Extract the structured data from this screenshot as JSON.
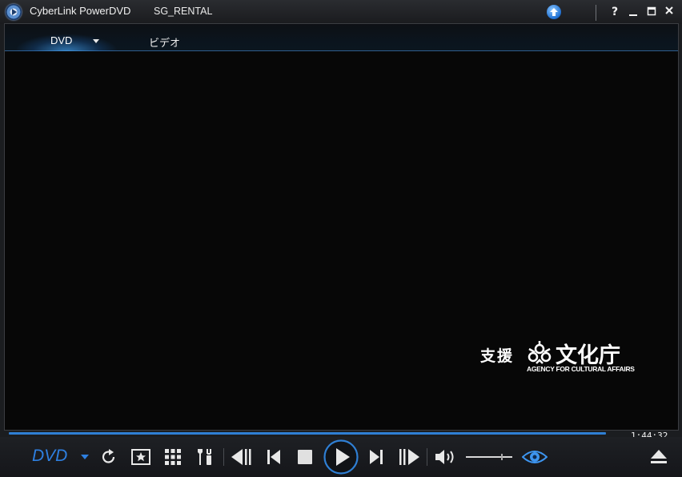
{
  "window": {
    "app_title": "CyberLink PowerDVD",
    "disc_title": "SG_RENTAL",
    "help_label": "?",
    "minimize_label": "–",
    "maximize_label": "□",
    "close_label": "✕"
  },
  "tabs": {
    "dvd_label": "DVD",
    "video_label": "ビデオ"
  },
  "video": {
    "sponsor_text": "支援",
    "agency_name_jp": "文化庁",
    "agency_name_en": "AGENCY FOR CULTURAL AFFAIRS"
  },
  "playback": {
    "time": "1:44:32",
    "mode_label": "DVD",
    "progress_percent": 100
  },
  "colors": {
    "accent": "#2e7fe0",
    "background": "#050505",
    "chrome": "#1b1d20"
  },
  "icons": [
    "app-logo-icon",
    "upgrade-arrow-icon",
    "repeat-icon",
    "movie-chapter-icon",
    "grid-menu-icon",
    "settings-tools-icon",
    "frame-back-icon",
    "previous-icon",
    "stop-icon",
    "play-icon",
    "next-icon",
    "frame-forward-icon",
    "volume-icon",
    "eye-icon",
    "eject-icon"
  ]
}
